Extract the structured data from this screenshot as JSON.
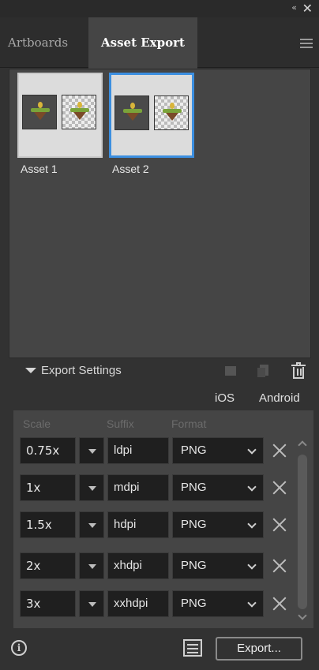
{
  "titlebar": {
    "collapse_glyph": "«",
    "close_glyph": "✕"
  },
  "tabs": [
    {
      "label": "Artboards",
      "active": false
    },
    {
      "label": "Asset Export",
      "active": true
    }
  ],
  "assets": [
    {
      "label": "Asset 1",
      "selected": false
    },
    {
      "label": "Asset 2",
      "selected": true
    }
  ],
  "settings": {
    "title": "Export Settings",
    "presets": {
      "ios": "iOS",
      "android": "Android"
    },
    "columns": {
      "scale": "Scale",
      "suffix": "Suffix",
      "format": "Format"
    },
    "rows": [
      {
        "scale": "0.75x",
        "suffix": "ldpi",
        "format": "PNG"
      },
      {
        "scale": "1x",
        "suffix": "mdpi",
        "format": "PNG"
      },
      {
        "scale": "1.5x",
        "suffix": "hdpi",
        "format": "PNG"
      },
      {
        "scale": "2x",
        "suffix": "xhdpi",
        "format": "PNG"
      },
      {
        "scale": "3x",
        "suffix": "xxhdpi",
        "format": "PNG"
      }
    ]
  },
  "footer": {
    "info_glyph": "i",
    "export_label": "Export..."
  },
  "colors": {
    "selected_border": "#3c8fe0",
    "panel_bg": "#323232",
    "content_bg": "#454545"
  }
}
